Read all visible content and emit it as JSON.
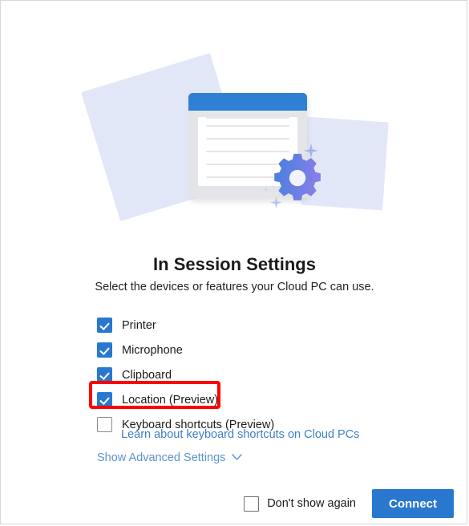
{
  "dialog": {
    "title": "In Session Settings",
    "subtitle": "Select the devices or features your Cloud PC can use."
  },
  "illustration": {
    "window_icon": "settings-window-illustration",
    "gear_icon": "gear-icon",
    "sparkle_icon": "sparkle-icon",
    "colors": {
      "lavender": "#e2e7f8",
      "titlebar_blue": "#2f7fd4",
      "gear_blue": "#4a7fe0",
      "gear_purple": "#8b7fe8"
    }
  },
  "options": [
    {
      "label": "Printer",
      "checked": true
    },
    {
      "label": "Microphone",
      "checked": true
    },
    {
      "label": "Clipboard",
      "checked": true
    },
    {
      "label": "Location (Preview)",
      "checked": true,
      "highlighted": true
    },
    {
      "label": "Keyboard shortcuts (Preview)",
      "checked": false
    }
  ],
  "learn_link": {
    "text": "Learn about keyboard shortcuts on Cloud PCs",
    "color": "#3b7fc4"
  },
  "advanced": {
    "label": "Show Advanced Settings",
    "chevron": "chevron-down-icon",
    "color": "#5a94cf"
  },
  "footer": {
    "dont_show_again": {
      "label": "Don't show again",
      "checked": false
    },
    "connect_label": "Connect",
    "connect_color": "#2878d0"
  },
  "highlight": {
    "color": "#ff0000",
    "target": "Location (Preview)"
  }
}
